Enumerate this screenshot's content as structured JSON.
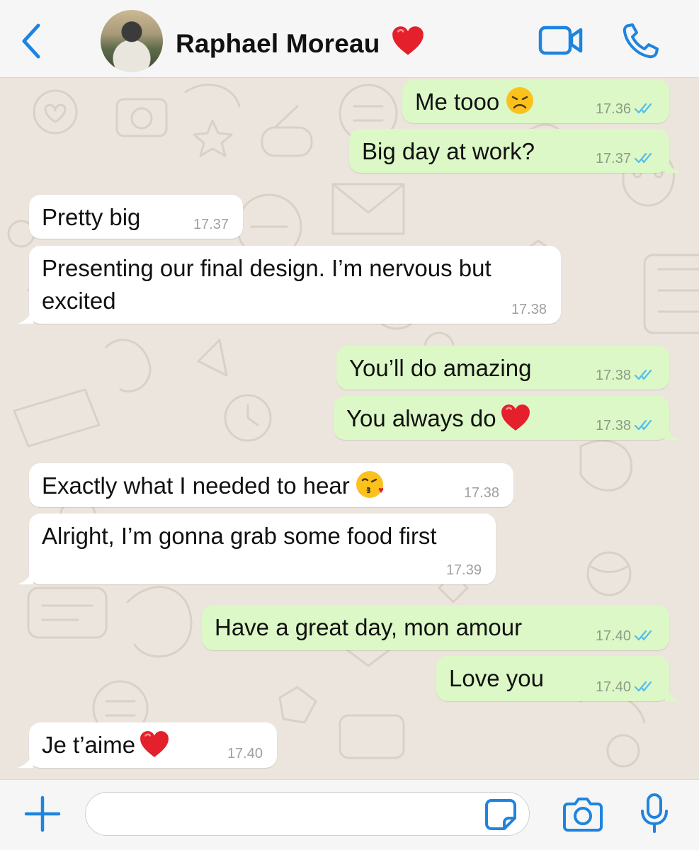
{
  "header": {
    "contact_name": "Raphael Moreau",
    "icons": [
      "chevron-left-icon",
      "video-call-icon",
      "phone-icon",
      "heart-emoji"
    ]
  },
  "colors": {
    "accent": "#1e84e0",
    "outgoing_bubble": "#dcf8c6",
    "incoming_bubble": "#ffffff",
    "read_ticks": "#53bdeb",
    "wallpaper": "#ece5dd"
  },
  "messages": [
    {
      "direction": "out",
      "text": "Me tooo",
      "emoji": "disappointed-face",
      "time": "17.36",
      "status": "read"
    },
    {
      "direction": "out",
      "text": "Big day at work?",
      "time": "17.37",
      "status": "read"
    },
    {
      "direction": "in",
      "text": "Pretty big",
      "time": "17.37"
    },
    {
      "direction": "in",
      "text_line1": "Presenting our final design. I’m nervous but",
      "text_line2": "excited",
      "time": "17.38"
    },
    {
      "direction": "out",
      "text": "You’ll do amazing",
      "time": "17.38",
      "status": "read"
    },
    {
      "direction": "out",
      "text": "You always do",
      "emoji": "red-heart",
      "time": "17.38",
      "status": "read"
    },
    {
      "direction": "in",
      "text": "Exactly what I needed to hear",
      "emoji": "face-blowing-kiss",
      "time": "17.38"
    },
    {
      "direction": "in",
      "text": "Alright, I’m gonna grab some food first",
      "time": "17.39"
    },
    {
      "direction": "out",
      "text": "Have a great day, mon amour",
      "time": "17.40",
      "status": "read"
    },
    {
      "direction": "out",
      "text": "Love you",
      "time": "17.40",
      "status": "read"
    },
    {
      "direction": "in",
      "text": "Je t’aime",
      "emoji": "red-heart",
      "time": "17.40"
    }
  ],
  "composer": {
    "value": "",
    "icons": [
      "plus-icon",
      "sticker-icon",
      "camera-icon",
      "microphone-icon"
    ]
  }
}
